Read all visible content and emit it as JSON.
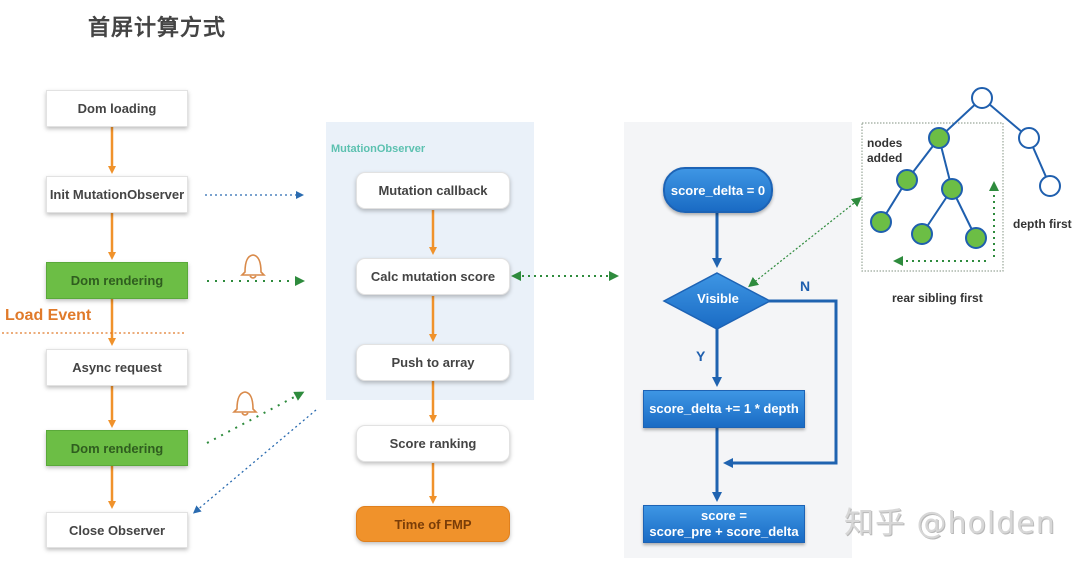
{
  "title": "首屏计算方式",
  "colors": {
    "flow_arrow": "#f0922b",
    "green_box": "#6cbe45",
    "blue_node": "#2a7fd4",
    "dotted_green": "#2e8b3d",
    "dotted_blue": "#2a6bb0",
    "load_event": "#e07a2a",
    "panel_bg": "#eaf1f9"
  },
  "left_flow": {
    "steps": [
      {
        "label": "Dom loading",
        "style": "white"
      },
      {
        "label": "Init MutationObserver",
        "style": "white"
      },
      {
        "label": "Dom rendering",
        "style": "green"
      },
      {
        "label": "Async request",
        "style": "white"
      },
      {
        "label": "Dom rendering",
        "style": "green"
      },
      {
        "label": "Close Observer",
        "style": "white"
      }
    ],
    "load_event_label": "Load Event",
    "icons": [
      "bell-icon",
      "bell-icon"
    ]
  },
  "observer_flow": {
    "panel_label": "MutationObserver",
    "steps": [
      {
        "label": "Mutation callback"
      },
      {
        "label": "Calc mutation score"
      },
      {
        "label": "Push to array"
      },
      {
        "label": "Score ranking"
      },
      {
        "label": "Time of FMP"
      }
    ]
  },
  "score_flow": {
    "start": "score_delta = 0",
    "decision": "Visible",
    "yes_label": "Y",
    "no_label": "N",
    "increment": "score_delta += 1 * depth",
    "result_line1": "score =",
    "result_line2": "score_pre + score_delta"
  },
  "tree": {
    "nodes_added_line1": "nodes",
    "nodes_added_line2": "added",
    "depth_first": "depth first",
    "rear_sibling_first": "rear sibling first"
  },
  "watermark": "知乎 @holden"
}
